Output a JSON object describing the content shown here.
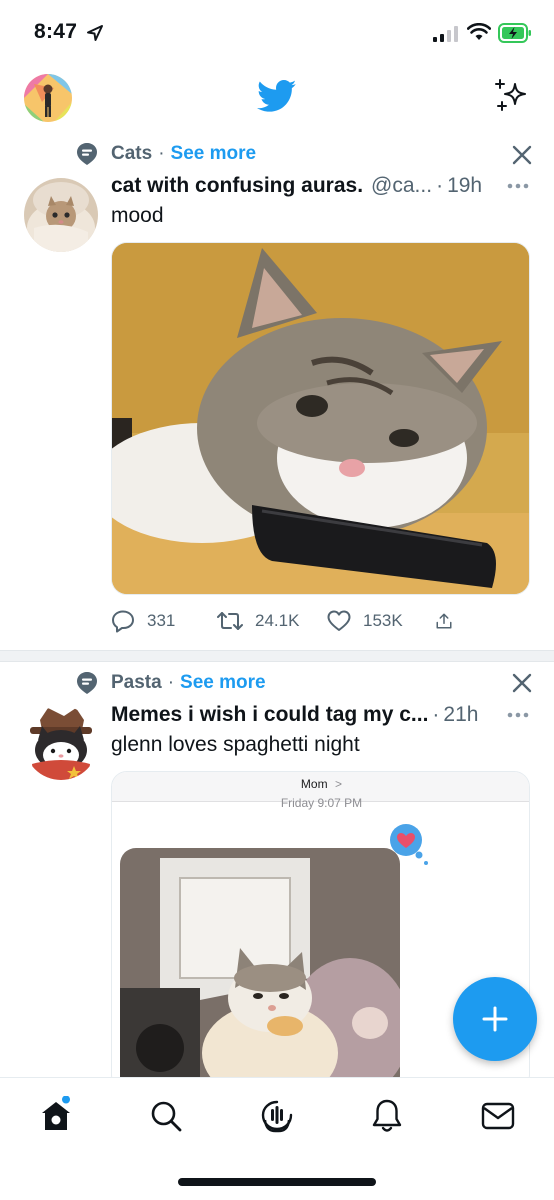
{
  "status_bar": {
    "time": "8:47"
  },
  "colors": {
    "accent": "#1d9bf0",
    "text_primary": "#0f1419",
    "text_secondary": "#536471",
    "battery_green": "#34c759"
  },
  "header": {
    "logo_icon": "twitter-bird-icon",
    "right_icon": "sparkle-icon"
  },
  "tweets": [
    {
      "topic": "Cats",
      "dot": "·",
      "see_more": "See more",
      "name": "cat with confusing auras.",
      "handle": "@ca...",
      "sep": "·",
      "time": "19h",
      "text": "mood",
      "media_description": "cat resting its chin on a phone",
      "actions": {
        "replies": "331",
        "retweets": "24.1K",
        "likes": "153K"
      }
    },
    {
      "topic": "Pasta",
      "dot": "·",
      "see_more": "See more",
      "name": "Memes i wish i could tag my c...",
      "sep": "·",
      "time": "21h",
      "text": "glenn loves spaghetti night",
      "media": {
        "contact": "Mom",
        "chevron": ">",
        "timestamp": "Friday 9:07 PM"
      }
    }
  ],
  "tab_bar": {
    "items": [
      "home-icon",
      "search-icon",
      "spaces-icon",
      "notifications-icon",
      "messages-icon"
    ]
  },
  "fab": {
    "icon": "plus-icon"
  }
}
